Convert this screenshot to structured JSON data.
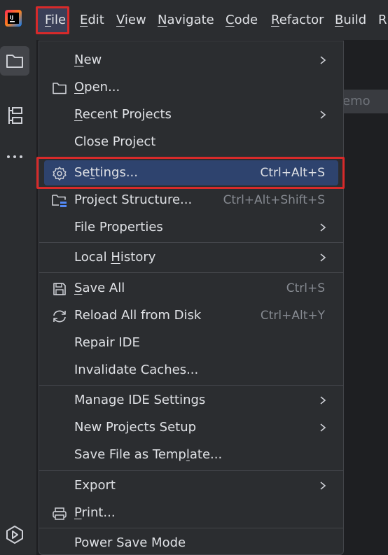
{
  "menubar": {
    "items": [
      {
        "label": "File",
        "mnemonic": "F",
        "rest": "ile"
      },
      {
        "label": "Edit",
        "mnemonic": "E",
        "rest": "dit"
      },
      {
        "label": "View",
        "mnemonic": "V",
        "rest": "iew"
      },
      {
        "label": "Navigate",
        "mnemonic": "N",
        "rest": "avigate"
      },
      {
        "label": "Code",
        "mnemonic": "C",
        "rest": "ode"
      },
      {
        "label": "Refactor",
        "mnemonic": "R",
        "rest": "efactor"
      },
      {
        "label": "Build",
        "mnemonic": "B",
        "rest": "uild"
      },
      {
        "label": "R",
        "mnemonic": "R",
        "rest": ""
      }
    ]
  },
  "background": {
    "tab_text": "emo"
  },
  "file_menu": {
    "new": {
      "pre": "",
      "mn": "N",
      "post": "ew"
    },
    "open": {
      "pre": "",
      "mn": "O",
      "post": "pen..."
    },
    "recent_projects": {
      "pre": "",
      "mn": "R",
      "post": "ecent Projects"
    },
    "close_project": {
      "pre": "Close Project",
      "mn": "",
      "post": ""
    },
    "settings": {
      "pre": "Se",
      "mn": "t",
      "post": "tings...",
      "shortcut": "Ctrl+Alt+S"
    },
    "project_structure": {
      "pre": "Project Structure...",
      "mn": "",
      "post": "",
      "shortcut": "Ctrl+Alt+Shift+S"
    },
    "file_properties": {
      "pre": "File Properties",
      "mn": "",
      "post": ""
    },
    "local_history": {
      "pre": "Local ",
      "mn": "H",
      "post": "istory"
    },
    "save_all": {
      "pre": "",
      "mn": "S",
      "post": "ave All",
      "shortcut": "Ctrl+S"
    },
    "reload_all": {
      "pre": "Reload All from Disk",
      "mn": "",
      "post": "",
      "shortcut": "Ctrl+Alt+Y"
    },
    "repair_ide": {
      "pre": "Repair IDE",
      "mn": "",
      "post": ""
    },
    "invalidate_caches": {
      "pre": "Invalidate Caches...",
      "mn": "",
      "post": ""
    },
    "manage_ide_settings": {
      "pre": "Manage IDE Settings",
      "mn": "",
      "post": ""
    },
    "new_projects_setup": {
      "pre": "New Projects Setup",
      "mn": "",
      "post": ""
    },
    "save_file_as_template": {
      "pre": "Save File as Temp",
      "mn": "l",
      "post": "ate..."
    },
    "export": {
      "pre": "Export",
      "mn": "",
      "post": ""
    },
    "print": {
      "pre": "",
      "mn": "P",
      "post": "rint..."
    },
    "power_save_mode": {
      "pre": "Power Save Mode",
      "mn": "",
      "post": ""
    }
  },
  "colors": {
    "selection": "#2e436e",
    "annotation_outline": "#d72a2a",
    "menu_bg": "#2b2d30"
  }
}
